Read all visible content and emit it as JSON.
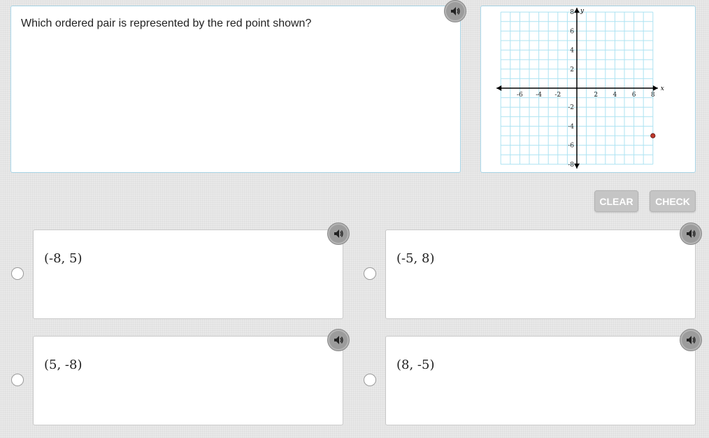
{
  "question": {
    "text": "Which ordered pair is represented by the red point shown?",
    "audio_icon": "speaker-icon"
  },
  "graph": {
    "x_range": [
      -8,
      8
    ],
    "y_range": [
      -8,
      8
    ],
    "x_tick_labels": [
      "-6",
      "-4",
      "-2",
      "2",
      "4",
      "6",
      "8"
    ],
    "y_tick_labels": [
      "8",
      "6",
      "4",
      "2",
      "-2",
      "-4",
      "-6",
      "-8"
    ],
    "x_axis_label": "x",
    "y_axis_label": "y",
    "grid_color": "#aee3f2",
    "point": {
      "x": 8,
      "y": -5,
      "color": "#c0392b"
    }
  },
  "buttons": {
    "clear_label": "CLEAR",
    "check_label": "CHECK"
  },
  "choices": [
    {
      "label": "(-8, 5)"
    },
    {
      "label": "(-5, 8)"
    },
    {
      "label": "(5, -8)"
    },
    {
      "label": "(8, -5)"
    }
  ]
}
